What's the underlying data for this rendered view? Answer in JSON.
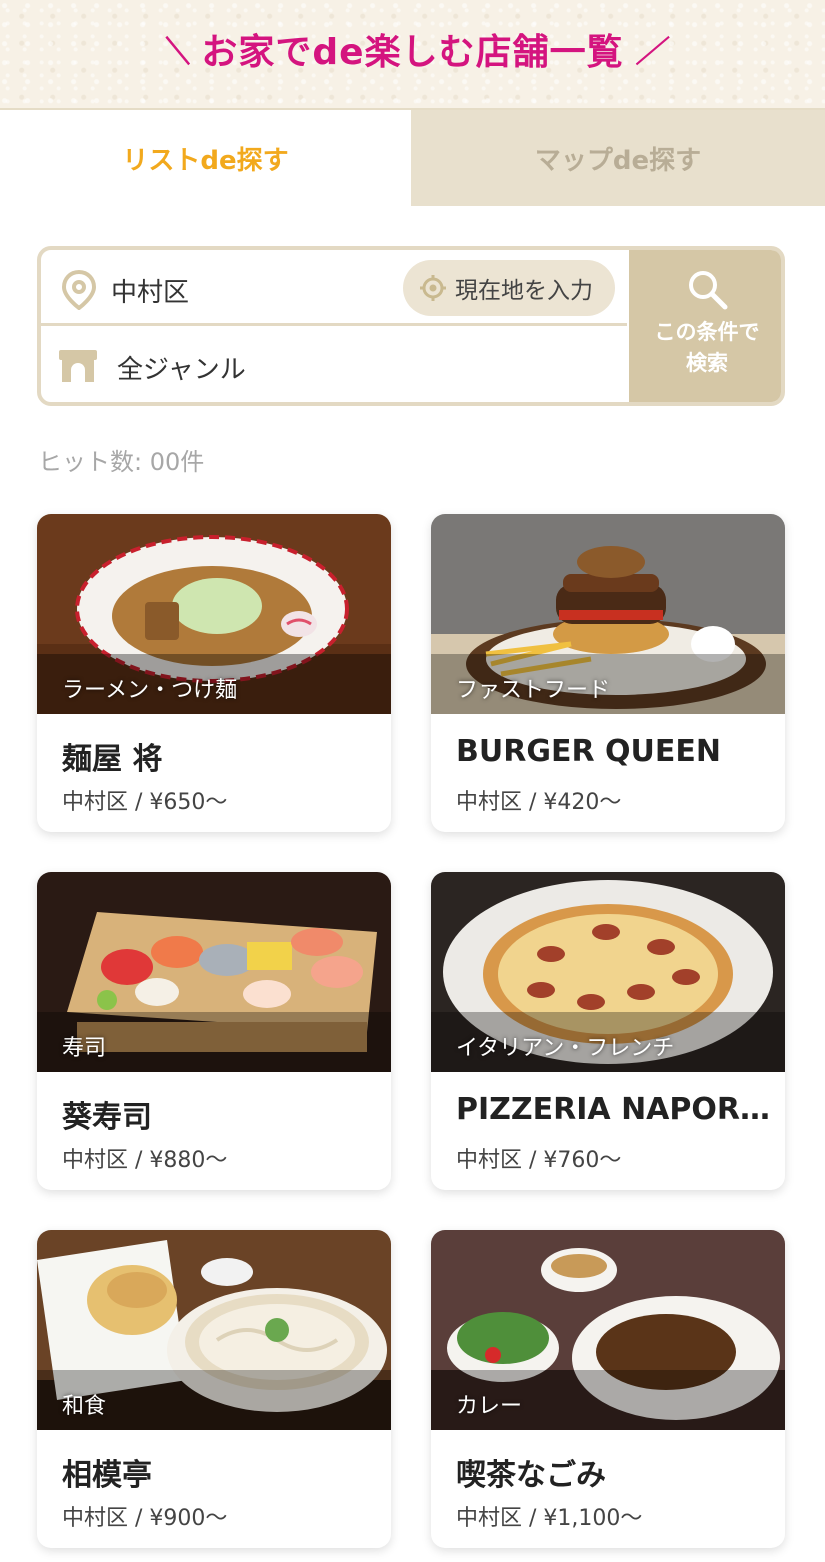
{
  "header": {
    "title": "お家でde楽しむ店舗一覧",
    "accent_color": "#d4147f"
  },
  "tabs": [
    {
      "label": "リストde探す",
      "active": true
    },
    {
      "label": "マップde探す",
      "active": false
    }
  ],
  "search": {
    "area_value": "中村区",
    "location_button": "現在地を入力",
    "genre_value": "全ジャンル",
    "submit_label": "この条件で\n検索"
  },
  "hits": "ヒット数: 00件",
  "shops": [
    {
      "name": "麺屋 将",
      "genre": "ラーメン・つけ麺",
      "meta": "中村区 / ¥650〜",
      "image": "ramen-photo"
    },
    {
      "name": "BURGER QUEEN",
      "genre": "ファストフード",
      "meta": "中村区 / ¥420〜",
      "image": "burger-photo"
    },
    {
      "name": "葵寿司",
      "genre": "寿司",
      "meta": "中村区 / ¥880〜",
      "image": "sushi-photo"
    },
    {
      "name": "PIZZERIA NAPOR…",
      "genre": "イタリアン・フレンチ",
      "meta": "中村区 / ¥760〜",
      "image": "pizza-photo"
    },
    {
      "name": "相模亭",
      "genre": "和食",
      "meta": "中村区 / ¥900〜",
      "image": "udon-photo"
    },
    {
      "name": "喫茶なごみ",
      "genre": "カレー",
      "meta": "中村区 / ¥1,100〜",
      "image": "curry-photo"
    }
  ]
}
